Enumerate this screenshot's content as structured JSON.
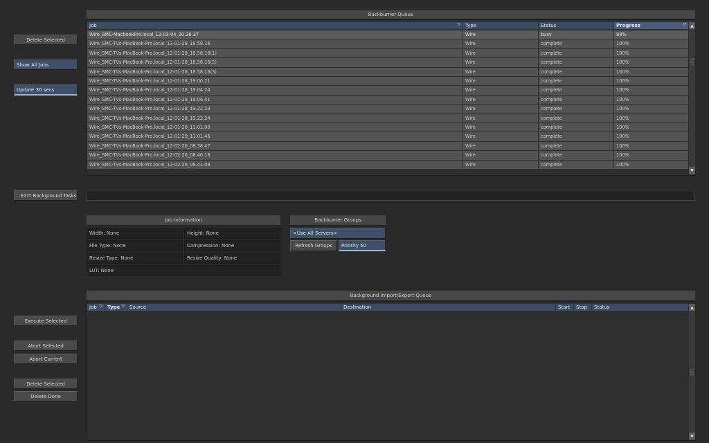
{
  "left_buttons": {
    "delete_selected_top": "Delete Selected",
    "show_all_jobs": "Show All Jobs",
    "update_interval": "Update 30 secs",
    "exit_background_tasks": "EXIT Background Tasks",
    "execute_selected": "Execute Selected",
    "abort_selected": "Abort Selected",
    "abort_current": "Abort Current",
    "delete_selected_bottom": "Delete Selected",
    "delete_done": "Delete Done"
  },
  "backburner_queue": {
    "title": "Backburner Queue",
    "columns": [
      "Job",
      "Type",
      "Status",
      "Progress"
    ],
    "rows": [
      {
        "job": "Wire_SMC-MacbookPro.local_12-03-04_20.36.37",
        "type": "Wire",
        "status": "busy",
        "progress": "88%"
      },
      {
        "job": "Wire_SMC-TVs-MacBook-Pro.local_12-01-28_18.58.16",
        "type": "Wire",
        "status": "complete",
        "progress": "100%"
      },
      {
        "job": "Wire_SMC-TVs-MacBook-Pro.local_12-01-28_18.58.16(1)",
        "type": "Wire",
        "status": "complete",
        "progress": "100%"
      },
      {
        "job": "Wire_SMC-TVs-MacBook-Pro.local_12-01-28_18.58.16(2)",
        "type": "Wire",
        "status": "complete",
        "progress": "100%"
      },
      {
        "job": "Wire_SMC-TVs-MacBook-Pro.local_12-01-28_18.58.16(3)",
        "type": "Wire",
        "status": "complete",
        "progress": "100%"
      },
      {
        "job": "Wire_SMC-TVs-MacBook-Pro.local_12-01-28_19.00.21",
        "type": "Wire",
        "status": "complete",
        "progress": "100%"
      },
      {
        "job": "Wire_SMC-TVs-MacBook-Pro.local_12-01-28_19.04.24",
        "type": "Wire",
        "status": "complete",
        "progress": "100%"
      },
      {
        "job": "Wire_SMC-TVs-MacBook-Pro.local_12-01-28_19.06.41",
        "type": "Wire",
        "status": "complete",
        "progress": "100%"
      },
      {
        "job": "Wire_SMC-TVs-MacBook-Pro.local_12-01-28_19.22.23",
        "type": "Wire",
        "status": "complete",
        "progress": "100%"
      },
      {
        "job": "Wire_SMC-TVs-MacBook-Pro.local_12-01-28_19.22.24",
        "type": "Wire",
        "status": "complete",
        "progress": "100%"
      },
      {
        "job": "Wire_SMC-TVs-MacBook-Pro.local_12-01-29_11.01.00",
        "type": "Wire",
        "status": "complete",
        "progress": "100%"
      },
      {
        "job": "Wire_SMC-TVs-MacBook-Pro.local_12-01-29_11.01.46",
        "type": "Wire",
        "status": "complete",
        "progress": "100%"
      },
      {
        "job": "Wire_SMC-TVs-MacBook-Pro.local_12-02-26_08.38.47",
        "type": "Wire",
        "status": "complete",
        "progress": "100%"
      },
      {
        "job": "Wire_SMC-TVs-MacBook-Pro.local_12-02-26_08.40.18",
        "type": "Wire",
        "status": "complete",
        "progress": "100%"
      },
      {
        "job": "Wire_SMC-TVs-MacBook-Pro.local_12-02-26_08.41.08",
        "type": "Wire",
        "status": "complete",
        "progress": "100%"
      }
    ]
  },
  "job_information": {
    "title": "Job Information",
    "width": "Width: None",
    "height": "Height: None",
    "file_type": "File Type: None",
    "compression": "Compression: None",
    "resize_type": "Resize Type: None",
    "resize_quality": "Resize Quality: None",
    "lut": "LUT: None"
  },
  "backburner_groups": {
    "title": "Backburner Groups",
    "server_selection": "<Use All Servers>",
    "refresh_groups": "Refresh Groups",
    "priority": "Priority 50"
  },
  "import_export_queue": {
    "title": "Background Import/Export Queue",
    "columns": [
      "Job",
      "Type",
      "Source",
      "Destination",
      "Start",
      "Stop",
      "Status"
    ]
  },
  "icons": {
    "sort": "sort-triangle-icon",
    "scroll_up": "scroll-up-arrow-icon",
    "scroll_down": "scroll-down-arrow-icon",
    "radio": "radio-dot-icon"
  },
  "colors": {
    "background": "#2a2a2a",
    "header_blue": "#3a4b64",
    "active_button_blue": "#3e5069",
    "row_gray": "#525252"
  }
}
